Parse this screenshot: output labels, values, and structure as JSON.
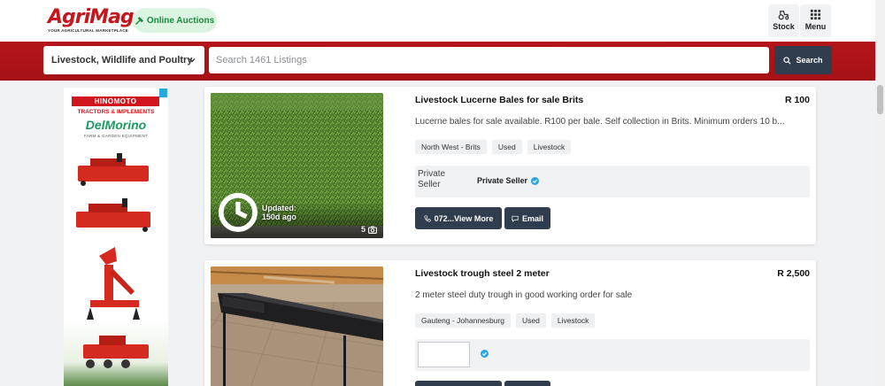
{
  "header": {
    "logo_text": "AgriMag",
    "logo_tagline": "YOUR AGRICULTURAL MARKETPLACE",
    "auctions_label": "Online Auctions",
    "stock_label": "Stock",
    "menu_label": "Menu"
  },
  "search": {
    "category": "Livestock, Wildlife and Poultry",
    "placeholder": "Search 1461 Listings",
    "button_label": "Search"
  },
  "ad": {
    "brand": "HINOMOTO",
    "subtitle": "TRACTORS & IMPLEMENTS",
    "partner": "DelMorino",
    "partner_sub": "FARM & GARDEN EQUIPMENT"
  },
  "listings": [
    {
      "title": "Livestock Lucerne Bales for sale Brits",
      "price": "R 100",
      "description": "Lucerne bales for sale available. R100 per bale. Self collection in Brits. Minimum orders 10 b...",
      "tags": [
        "North West - Brits",
        "Used",
        "Livestock"
      ],
      "updated": "Updated: 150d ago",
      "photo_count": "5",
      "seller_image_alt": "Private Seller",
      "seller_name": "Private Seller",
      "phone_label": "072...View More",
      "email_label": "Email"
    },
    {
      "title": "Livestock trough steel 2 meter",
      "price": "R 2,500",
      "description": "2 meter steel duty trough in good working order for sale",
      "tags": [
        "Gauteng - Johannesburg",
        "Used",
        "Livestock"
      ],
      "seller_name": ""
    }
  ],
  "colors": {
    "brand_red": "#c4161c",
    "dark_button": "#2f3d4e",
    "verified_blue": "#2aa7df",
    "auction_green": "#198a3c"
  }
}
